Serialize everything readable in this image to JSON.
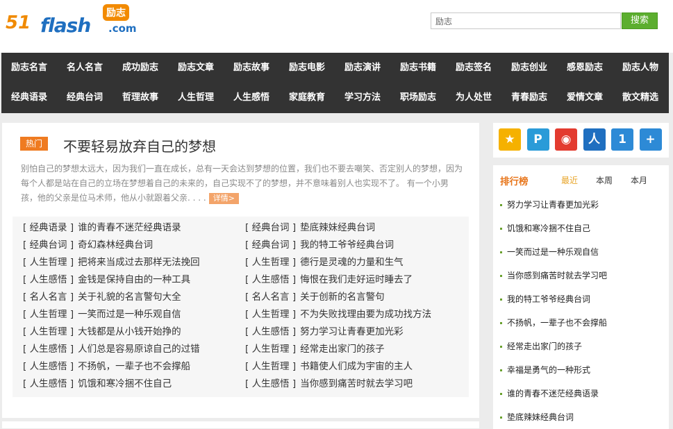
{
  "logo": {
    "num": "51",
    "brand": "flash",
    "domain": ".com",
    "tag": "励志"
  },
  "search": {
    "value": "励志",
    "button": "搜索"
  },
  "nav": {
    "row1": [
      "励志名言",
      "名人名言",
      "成功励志",
      "励志文章",
      "励志故事",
      "励志电影",
      "励志演讲",
      "励志书籍",
      "励志签名",
      "励志创业",
      "感恩励志",
      "励志人物"
    ],
    "row2": [
      "经典语录",
      "经典台词",
      "哲理故事",
      "人生哲理",
      "人生感悟",
      "家庭教育",
      "学习方法",
      "职场励志",
      "为人处世",
      "青春励志",
      "爱情文章",
      "散文精选"
    ]
  },
  "featured": {
    "tag": "热门",
    "title": "不要轻易放弃自己的梦想",
    "summary": "别怕自己的梦想太远大，因为我们一直在成长，总有一天会达到梦想的位置，我们也不要去嘲笑、否定别人的梦想，因为每个人都是站在自己的立场在梦想着自己的未来的，自己实现不了的梦想，并不意味着别人也实现不了。 有一个小男孩，他的父亲是位马术师，他从小就跟着父亲. . . .",
    "more": "详情>"
  },
  "articles": [
    {
      "cat": "经典语录",
      "title": "谁的青春不迷茫经典语录"
    },
    {
      "cat": "经典台词",
      "title": "垫底辣妹经典台词"
    },
    {
      "cat": "经典台词",
      "title": "奇幻森林经典台词"
    },
    {
      "cat": "经典台词",
      "title": "我的特工爷爷经典台词"
    },
    {
      "cat": "人生哲理",
      "title": "把将来当成过去那样无法挽回"
    },
    {
      "cat": "人生哲理",
      "title": "德行是灵魂的力量和生气"
    },
    {
      "cat": "人生感悟",
      "title": "金钱是保持自由的一种工具"
    },
    {
      "cat": "人生感悟",
      "title": "悔恨在我们走好运时睡去了"
    },
    {
      "cat": "名人名言",
      "title": "关于礼貌的名言警句大全"
    },
    {
      "cat": "名人名言",
      "title": "关于创新的名言警句"
    },
    {
      "cat": "人生哲理",
      "title": "一笑而过是一种乐观自信"
    },
    {
      "cat": "人生哲理",
      "title": "不为失败找理由要为成功找方法"
    },
    {
      "cat": "人生哲理",
      "title": "大钱都是从小钱开始挣的"
    },
    {
      "cat": "人生感悟",
      "title": "努力学习让青春更加光彩"
    },
    {
      "cat": "人生感悟",
      "title": "人们总是容易原谅自己的过错"
    },
    {
      "cat": "人生哲理",
      "title": "经常走出家门的孩子"
    },
    {
      "cat": "人生感悟",
      "title": "不扬帆，一辈子也不会撑船"
    },
    {
      "cat": "人生哲理",
      "title": "书籍使人们成为宇宙的主人"
    },
    {
      "cat": "人生感悟",
      "title": "饥饿和寒冷捆不住自己"
    },
    {
      "cat": "人生感悟",
      "title": "当你感到痛苦时就去学习吧"
    }
  ],
  "share_icons": [
    {
      "name": "qzone-icon",
      "glyph": "★",
      "color": "#f5b100"
    },
    {
      "name": "tencent-weibo-icon",
      "glyph": "P",
      "color": "#2a9bd8"
    },
    {
      "name": "sina-weibo-icon",
      "glyph": "◉",
      "color": "#e33b2f"
    },
    {
      "name": "renren-icon",
      "glyph": "人",
      "color": "#1f6fc0"
    },
    {
      "name": "kaixin-icon",
      "glyph": "1",
      "color": "#2d8ad6"
    },
    {
      "name": "more-share-icon",
      "glyph": "+",
      "color": "#2d8ad6"
    }
  ],
  "rank": {
    "title": "排行榜",
    "tabs": [
      "最近",
      "本周",
      "本月"
    ],
    "items": [
      "努力学习让青春更加光彩",
      "饥饿和寒冷捆不住自己",
      "一笑而过是一种乐观自信",
      "当你感到痛苦时就去学习吧",
      "我的特工爷爷经典台词",
      "不扬帆，一辈子也不会撑船",
      "经常走出家门的孩子",
      "幸福是勇气的一种形式",
      "谁的青春不迷茫经典语录",
      "垫底辣妹经典台词"
    ]
  },
  "colors": {
    "nav_bg": "#333333",
    "accent": "#ef7b21",
    "search_btn": "#5cae2f"
  }
}
